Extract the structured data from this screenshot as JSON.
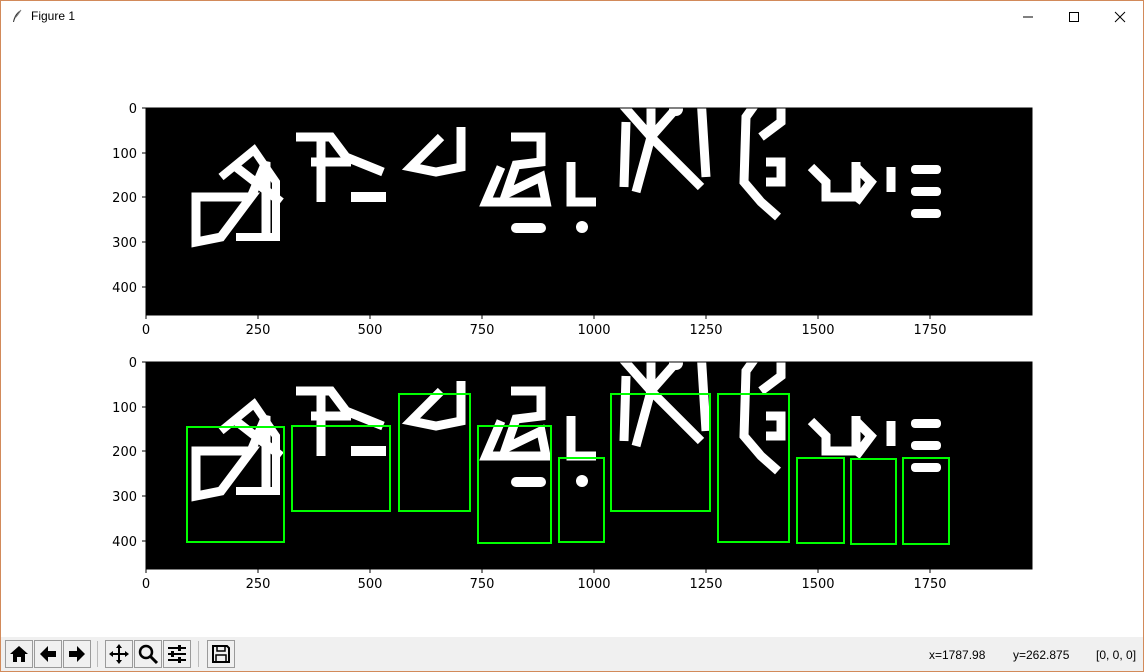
{
  "window": {
    "title": "Figure 1",
    "controls": [
      "minimize-icon",
      "maximize-icon",
      "close-icon"
    ]
  },
  "figure": {
    "axes": [
      {
        "xticks": [
          "0",
          "250",
          "500",
          "750",
          "1000",
          "1250",
          "1500",
          "1750"
        ],
        "yticks": [
          "0",
          "100",
          "200",
          "300",
          "400"
        ],
        "image": "binary-glyph-image"
      },
      {
        "xticks": [
          "0",
          "250",
          "500",
          "750",
          "1000",
          "1250",
          "1500",
          "1750"
        ],
        "yticks": [
          "0",
          "100",
          "200",
          "300",
          "400"
        ],
        "image": "binary-glyph-image-with-boxes",
        "box_color": "#00ff00"
      }
    ]
  },
  "toolbar": {
    "buttons": [
      "home-icon",
      "back-icon",
      "forward-icon",
      "pan-icon",
      "zoom-icon",
      "configure-subplots-icon",
      "save-icon"
    ]
  },
  "status": {
    "x": "x=1787.98",
    "y": "y=262.875",
    "value": "[0, 0, 0]"
  }
}
